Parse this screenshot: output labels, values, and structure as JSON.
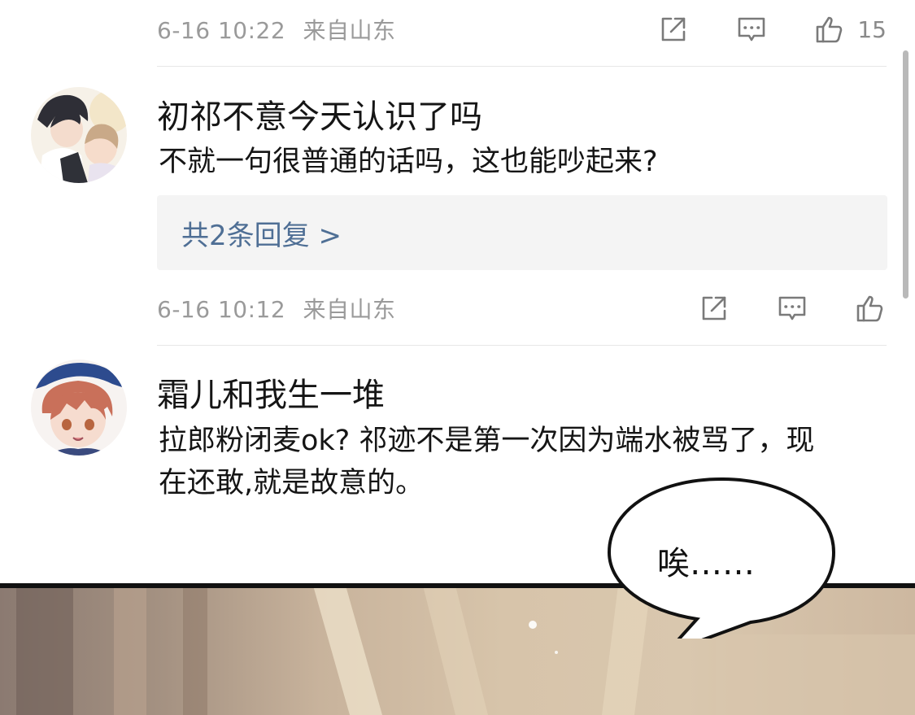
{
  "comment_top": {
    "time": "6-16 10:22",
    "location": "来自山东",
    "likes": "15"
  },
  "comment_1": {
    "username": "初祁不意今天认识了吗",
    "text": "不就一句很普通的话吗，这也能吵起来?",
    "replies_label": "共2条回复 >",
    "time": "6-16 10:12",
    "location": "来自山东"
  },
  "comment_2": {
    "username": "霜儿和我生一堆",
    "text_line1": "拉郎粉闭麦ok? 祁迹不是第一次因为端水被骂了，现",
    "text_line2": "在还敢,就是故意的。"
  },
  "comic": {
    "speech_bubble": "唉……"
  },
  "icons": {
    "share": "share-icon",
    "comment": "comment-icon",
    "like": "thumbs-up-icon"
  },
  "colors": {
    "meta_text": "#9a9a9a",
    "reply_link": "#4f6f95",
    "reply_bg": "#f4f4f4"
  }
}
